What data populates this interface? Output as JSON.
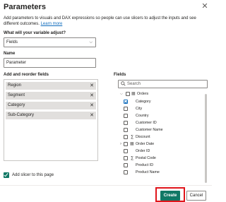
{
  "dialog": {
    "title": "Parameters",
    "description": "Add parameters to visuals and DAX expressions so people can use slicers to adjust the inputs and see different outcomes.",
    "learn_more": "Learn more"
  },
  "adjust": {
    "label": "What will your variable adjust?",
    "value": "Fields"
  },
  "name": {
    "label": "Name",
    "value": "Parameter"
  },
  "add_fields": {
    "label": "Add and reorder fields",
    "items": [
      "Region",
      "Segment",
      "Category",
      "Sub-Category"
    ]
  },
  "fields_panel": {
    "label": "Fields",
    "search_placeholder": "Search",
    "table": "Orders",
    "rows": [
      {
        "label": "Category",
        "checked": true
      },
      {
        "label": "City",
        "checked": false
      },
      {
        "label": "Country",
        "checked": false
      },
      {
        "label": "Customer ID",
        "checked": false
      },
      {
        "label": "Customer Name",
        "checked": false
      },
      {
        "label": "Discount",
        "checked": false,
        "icon": "sigma"
      },
      {
        "label": "Order Date",
        "checked": false,
        "icon": "calendar",
        "expandable": true
      },
      {
        "label": "Order ID",
        "checked": false
      },
      {
        "label": "Postal Code",
        "checked": false,
        "icon": "sigma"
      },
      {
        "label": "Product ID",
        "checked": false
      },
      {
        "label": "Product Name",
        "checked": false
      }
    ]
  },
  "add_slicer": {
    "label": "Add slicer to this page",
    "checked": true
  },
  "footer": {
    "create": "Create",
    "cancel": "Cancel"
  },
  "colors": {
    "primary": "#117865",
    "highlight": "#e0151b",
    "link": "#0f6cbd"
  }
}
